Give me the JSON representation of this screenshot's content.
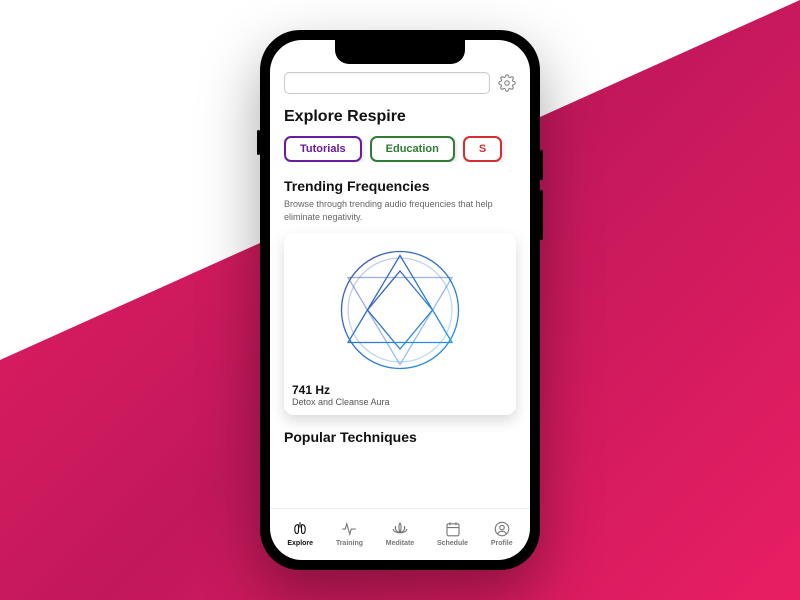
{
  "header": {
    "title": "Explore Respire"
  },
  "chips": [
    {
      "label": "Tutorials",
      "color": "purple"
    },
    {
      "label": "Education",
      "color": "green"
    },
    {
      "label": "S",
      "color": "red"
    }
  ],
  "trending": {
    "title": "Trending Frequencies",
    "desc": "Browse through trending audio frequencies that help eliminate negativity.",
    "card": {
      "hz": "741 Hz",
      "sub": "Detox and Cleanse Aura"
    }
  },
  "popular": {
    "title": "Popular Techniques"
  },
  "nav": [
    {
      "label": "Explore",
      "active": true
    },
    {
      "label": "Training",
      "active": false
    },
    {
      "label": "Meditate",
      "active": false
    },
    {
      "label": "Schedule",
      "active": false
    },
    {
      "label": "Profile",
      "active": false
    }
  ]
}
